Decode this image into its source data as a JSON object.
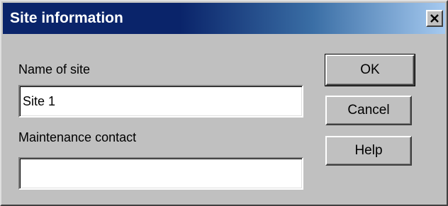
{
  "window": {
    "title": "Site information",
    "close_icon": "close-icon"
  },
  "form": {
    "name_label": "Name of site",
    "name_value": "Site 1",
    "contact_label": "Maintenance contact",
    "contact_value": ""
  },
  "buttons": {
    "ok": "OK",
    "cancel": "Cancel",
    "help": "Help"
  },
  "colors": {
    "titlebar_start": "#0a246a",
    "titlebar_end": "#a6caf0",
    "face": "#c0c0c0"
  }
}
